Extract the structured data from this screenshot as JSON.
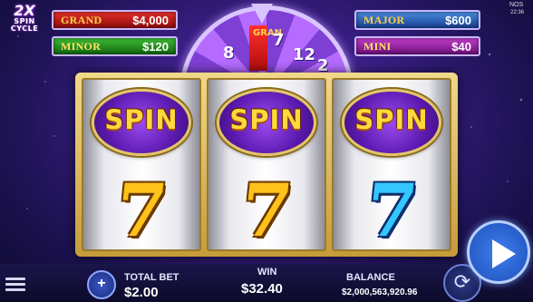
{
  "logo": {
    "line1": "2X",
    "line2": "SPIN",
    "line3": "CYCLE"
  },
  "jackpots": {
    "grand": {
      "label": "GRAND",
      "value": "$4,000"
    },
    "minor": {
      "label": "MINOR",
      "value": "$120"
    },
    "major": {
      "label": "MAJOR",
      "value": "$600"
    },
    "mini": {
      "label": "MINI",
      "value": "$40"
    }
  },
  "wheel": {
    "numbers": [
      "8",
      "7",
      "12",
      "2"
    ],
    "grand_segment_text": "GRAN"
  },
  "reels": [
    {
      "top_symbol": "SPIN",
      "bottom_symbol": "7",
      "bottom_color": "gold"
    },
    {
      "top_symbol": "SPIN",
      "bottom_symbol": "7",
      "bottom_color": "gold"
    },
    {
      "top_symbol": "SPIN",
      "bottom_symbol": "7",
      "bottom_color": "blue"
    }
  ],
  "bottom_bar": {
    "total_bet_label": "TOTAL BET",
    "total_bet_value": "$2.00",
    "win_label": "WIN",
    "win_value": "$32.40",
    "balance_label": "BALANCE",
    "balance_value": "$2,000,563,920.96"
  },
  "corner": {
    "brand": "NOS",
    "clock": "22:36"
  },
  "colors": {
    "grand": "#c81e1e",
    "minor": "#2a9a24",
    "major": "#2e6cc4",
    "mini": "#9e2aa8",
    "reel_gold": "#ffc11a",
    "reel_blue": "#34c6ff"
  }
}
